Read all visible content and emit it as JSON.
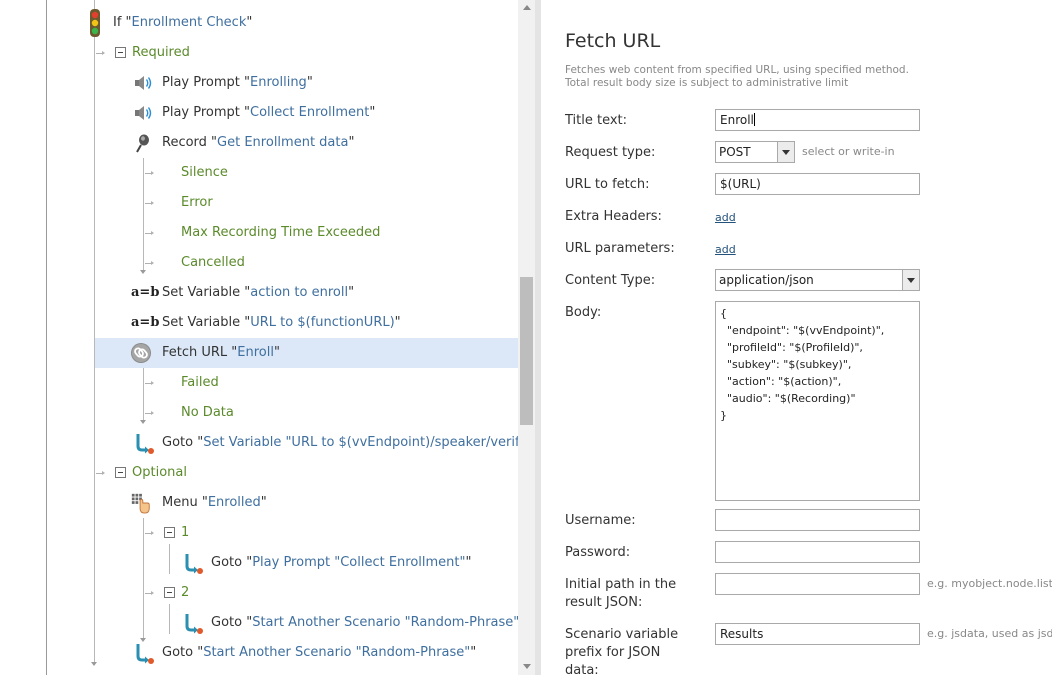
{
  "tree": {
    "rows": [
      {
        "id": "if",
        "keyword": "If",
        "value": "Enrollment Check",
        "icon": "traffic-light-icon"
      },
      {
        "id": "required",
        "label": "Required"
      },
      {
        "id": "play1",
        "keyword": "Play Prompt",
        "value": "Enrolling",
        "icon": "speaker-icon"
      },
      {
        "id": "play2",
        "keyword": "Play Prompt",
        "value": "Collect Enrollment",
        "icon": "speaker-icon"
      },
      {
        "id": "record",
        "keyword": "Record",
        "value": "Get Enrollment data",
        "icon": "microphone-icon"
      },
      {
        "id": "silence",
        "label": "Silence"
      },
      {
        "id": "error",
        "label": "Error"
      },
      {
        "id": "maxrec",
        "label": "Max Recording Time Exceeded"
      },
      {
        "id": "cancelled",
        "label": "Cancelled"
      },
      {
        "id": "setvar1",
        "keyword": "Set Variable",
        "value": "action to enroll",
        "icon": "assign-icon",
        "icon_text": "a=b"
      },
      {
        "id": "setvar2",
        "keyword": "Set Variable",
        "value": "URL to $(functionURL)",
        "icon": "assign-icon",
        "icon_text": "a=b"
      },
      {
        "id": "fetch",
        "keyword": "Fetch URL",
        "value": "Enroll",
        "icon": "link-chain-icon"
      },
      {
        "id": "failed",
        "label": "Failed"
      },
      {
        "id": "nodata",
        "label": "No Data"
      },
      {
        "id": "goto1",
        "keyword": "Goto",
        "value": "Set Variable \"URL to $(vvEndpoint)/speaker/verificat",
        "icon": "goto-icon"
      },
      {
        "id": "optional",
        "label": "Optional"
      },
      {
        "id": "menu",
        "keyword": "Menu",
        "value": "Enrolled",
        "icon": "keypad-hand-icon"
      },
      {
        "id": "opt1",
        "label": "1"
      },
      {
        "id": "goto2",
        "keyword": "Goto",
        "value": "Play Prompt \"Collect Enrollment\"",
        "icon": "goto-icon"
      },
      {
        "id": "opt2",
        "label": "2"
      },
      {
        "id": "goto3",
        "keyword": "Goto",
        "value": "Start Another Scenario \"Random-Phrase\"",
        "icon": "goto-icon"
      },
      {
        "id": "goto4",
        "keyword": "Goto",
        "value": "Start Another Scenario \"Random-Phrase\"",
        "icon": "goto-icon"
      }
    ]
  },
  "form": {
    "title": "Fetch URL",
    "description_line1": "Fetches web content from specified URL, using specified method.",
    "description_line2": "Total result body size is subject to administrative limit",
    "title_text_label": "Title text:",
    "title_text_value": "Enroll",
    "request_type_label": "Request type:",
    "request_type_value": "POST",
    "request_type_hint": "select or write-in",
    "url_label": "URL to fetch:",
    "url_value": "$(URL)",
    "extra_headers_label": "Extra Headers:",
    "extra_headers_link": "add",
    "url_params_label": "URL parameters:",
    "url_params_link": "add",
    "content_type_label": "Content Type:",
    "content_type_value": "application/json",
    "body_label": "Body:",
    "body_value": "{\n  \"endpoint\": \"$(vvEndpoint)\",\n  \"profileId\": \"$(ProfileId)\",\n  \"subkey\": \"$(subkey)\",\n  \"action\": \"$(action)\",\n  \"audio\": \"$(Recording)\"\n}",
    "username_label": "Username:",
    "username_value": "",
    "password_label": "Password:",
    "password_value": "",
    "initial_path_label_1": "Initial path in the",
    "initial_path_label_2": "result JSON:",
    "initial_path_value": "",
    "initial_path_hint": "e.g. myobject.node.list",
    "prefix_label_1": "Scenario variable",
    "prefix_label_2": "prefix for JSON",
    "prefix_label_3": "data:",
    "prefix_value": "Results",
    "prefix_hint": "e.g. jsdata, used as jsd"
  }
}
